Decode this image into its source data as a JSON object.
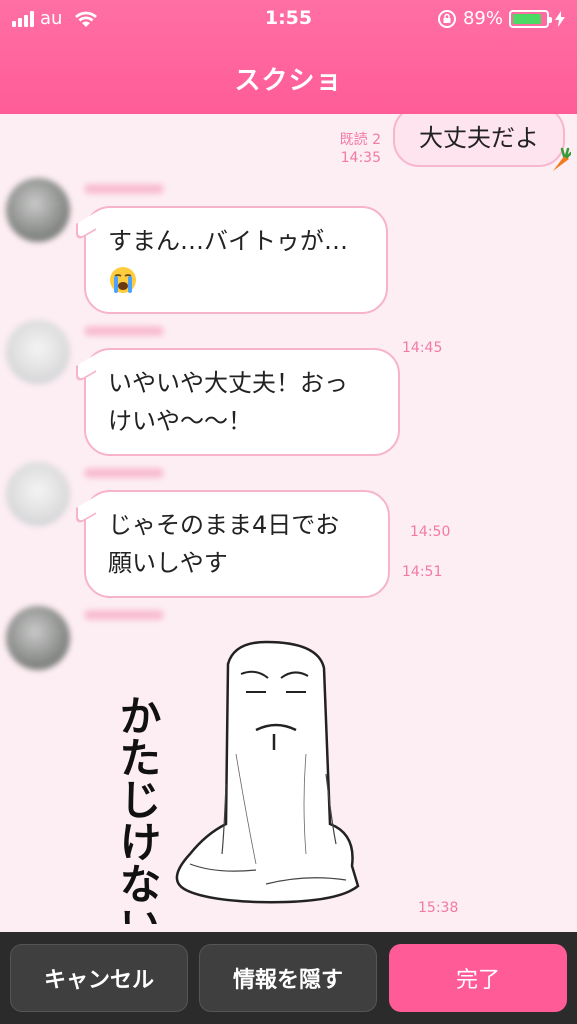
{
  "status_bar": {
    "carrier": "au",
    "time": "1:55",
    "battery": "89%",
    "battery_level": 0.89
  },
  "header": {
    "title": "スクショ"
  },
  "messages": {
    "sent": {
      "read_label": "既読 2",
      "time": "14:35",
      "text": "大丈夫だよ"
    },
    "m1": {
      "line1": "すまん…バイトゥが…",
      "time": "14:45",
      "emoji": "loudly-crying-face"
    },
    "m2": {
      "line1": "いやいや大丈夫！おっ",
      "line2": "けいや〜〜！",
      "time": "14:50"
    },
    "m3": {
      "line1": "じゃそのまま4日でお",
      "line2": "願いしやす",
      "time": "14:51"
    },
    "sticker": {
      "text": "かたじけない",
      "time": "15:38"
    }
  },
  "toolbar": {
    "cancel": "キャンセル",
    "hide": "情報を隠す",
    "done": "完了"
  },
  "colors": {
    "accent": "#ff5c97",
    "chat_bg": "#fdeef3",
    "bubble_border": "#f6b3cb",
    "time_text": "#f27aa5"
  }
}
